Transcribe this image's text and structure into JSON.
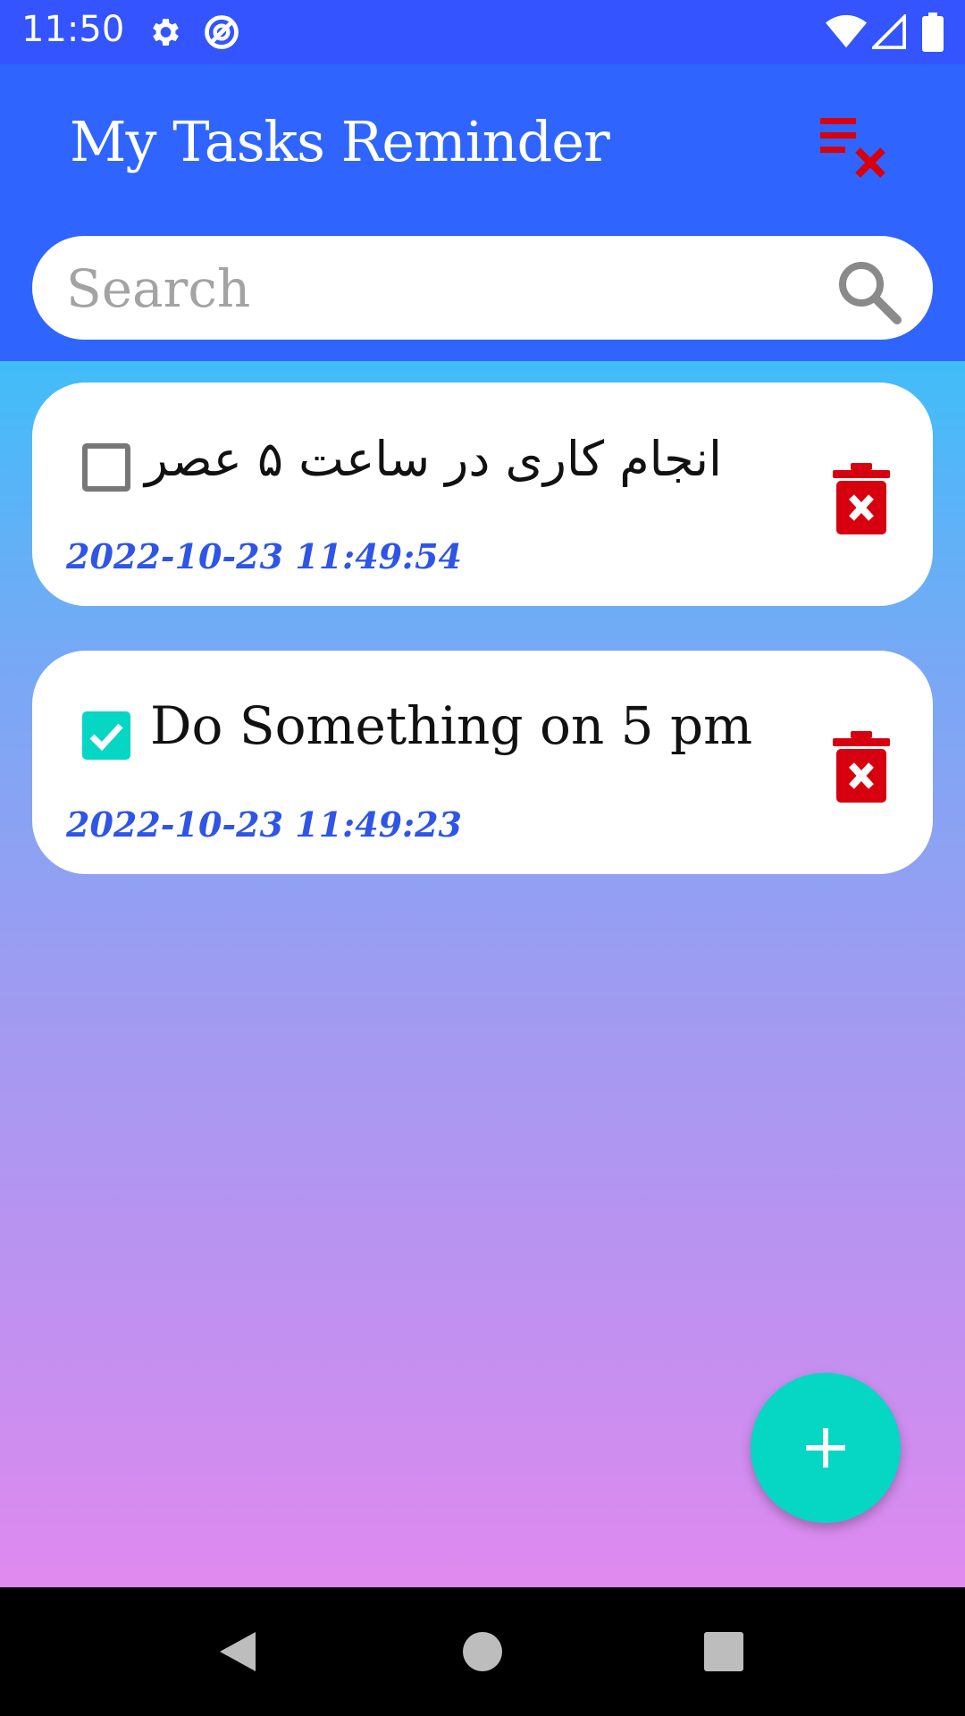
{
  "status_bar": {
    "time": "11:50",
    "icons": [
      "settings-gear-icon",
      "sync-blocked-icon",
      "wifi-icon",
      "cell-signal-icon",
      "battery-icon"
    ]
  },
  "app_bar": {
    "title": "My Tasks Reminder",
    "clear_all_icon": "clear-list-icon",
    "accent_color": "#2f65fe"
  },
  "search": {
    "placeholder": "Search",
    "value": "",
    "icon": "search-icon"
  },
  "tasks": [
    {
      "title": "انجام کاری در ساعت ۵ عصر",
      "date": "2022-10-23 11:49:54",
      "checked": false
    },
    {
      "title": "Do Something on 5 pm",
      "date": "2022-10-23 11:49:23",
      "checked": true
    }
  ],
  "colors": {
    "delete": "#d7000f",
    "fab": "#06d6c4",
    "date_text": "#2f55e6",
    "checkbox_checked": "#06d6c4"
  },
  "fab": {
    "icon": "plus-icon"
  },
  "nav_bar": {
    "icons": [
      "back-icon",
      "home-icon",
      "recents-icon"
    ]
  }
}
